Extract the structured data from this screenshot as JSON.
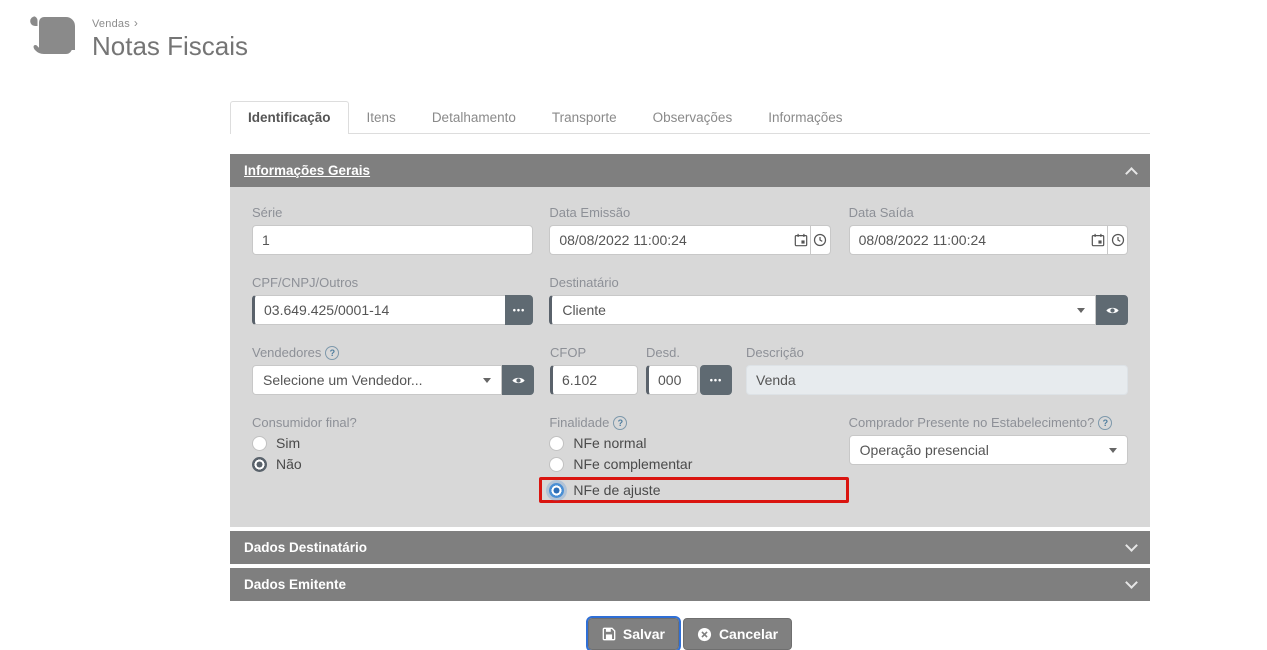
{
  "header": {
    "breadcrumb": "Vendas",
    "breadcrumb_sep": "›",
    "title": "Notas Fiscais",
    "icon": "scroll-icon"
  },
  "tabs": [
    {
      "label": "Identificação",
      "active": true
    },
    {
      "label": "Itens",
      "active": false
    },
    {
      "label": "Detalhamento",
      "active": false
    },
    {
      "label": "Transporte",
      "active": false
    },
    {
      "label": "Observações",
      "active": false
    },
    {
      "label": "Informações",
      "active": false
    }
  ],
  "sections": {
    "gerais": {
      "title": "Informações Gerais",
      "state": "expanded"
    },
    "destinatario": {
      "title": "Dados Destinatário",
      "state": "collapsed"
    },
    "emitente": {
      "title": "Dados Emitente",
      "state": "collapsed"
    }
  },
  "fields": {
    "serie": {
      "label": "Série",
      "value": "1"
    },
    "data_emissao": {
      "label": "Data Emissão",
      "value": "08/08/2022 11:00:24"
    },
    "data_saida": {
      "label": "Data Saída",
      "value": "08/08/2022 11:00:24"
    },
    "cpf_cnpj": {
      "label": "CPF/CNPJ/Outros",
      "value": "03.649.425/0001-14"
    },
    "destinatario": {
      "label": "Destinatário",
      "value": "Cliente"
    },
    "vendedores": {
      "label": "Vendedores",
      "value": "Selecione um Vendedor..."
    },
    "cfop": {
      "label": "CFOP",
      "value": "6.102"
    },
    "desd": {
      "label": "Desd.",
      "value": "000"
    },
    "descricao": {
      "label": "Descrição",
      "value": "Venda",
      "disabled": true
    },
    "consumidor_final": {
      "label": "Consumidor final?",
      "options": [
        {
          "label": "Sim",
          "selected": false
        },
        {
          "label": "Não",
          "selected": true
        }
      ]
    },
    "finalidade": {
      "label": "Finalidade",
      "options": [
        {
          "label": "NFe normal",
          "selected": false
        },
        {
          "label": "NFe complementar",
          "selected": false
        },
        {
          "label": "NFe de ajuste",
          "selected": true,
          "highlighted": true
        }
      ]
    },
    "comprador_presente": {
      "label": "Comprador Presente no Estabelecimento?",
      "value": "Operação presencial"
    }
  },
  "actions": {
    "save": "Salvar",
    "cancel": "Cancelar"
  },
  "glyphs": {
    "help": "?",
    "ellipsis": "•••"
  },
  "icons": [
    "scroll-icon",
    "calendar-icon",
    "clock-icon",
    "ellipsis-icon",
    "eye-icon",
    "help-icon",
    "chevron-up-icon",
    "chevron-down-icon",
    "save-icon",
    "cancel-icon"
  ],
  "colors": {
    "highlight_red": "#da1510",
    "radio_selected_blue": "#2c6db6",
    "radio_selected_gray": "#59626b",
    "accordion_bar": "#7f7f7f",
    "panel_background": "#d8d8d8",
    "dark_button": "#5f6a72",
    "action_button": "#808080",
    "save_focus_blue": "#2f6fd6"
  }
}
